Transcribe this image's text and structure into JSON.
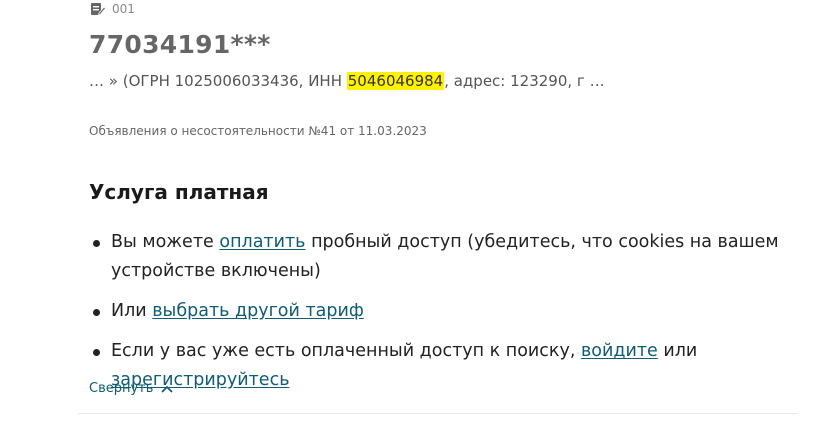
{
  "result": {
    "doc_icon": "document-edit-icon",
    "code": "001",
    "title": "77034191***",
    "snippet_before": "… » (ОГРН 1025006033436, ИНН ",
    "snippet_highlight": "5046046984",
    "snippet_after": ", адрес: 123290, г …",
    "source": "Объявления о несостоятельности №41 от 11.03.2023"
  },
  "paywall": {
    "title": "Услуга платная",
    "item1_before": "Вы можете ",
    "item1_link": "оплатить",
    "item1_after": " пробный доступ (убедитесь, что cookies на вашем устройстве включены)",
    "item2_before": "Или ",
    "item2_link": "выбрать другой тариф",
    "item3_before": "Если у вас уже есть оплаченный доступ к поиску, ",
    "item3_link1": "войдите",
    "item3_middle": " или ",
    "item3_link2": "зарегистрируйтесь"
  },
  "collapse": {
    "label": "Свернуть",
    "icon": "chevron-up-icon"
  },
  "colors": {
    "link": "#0f5c73",
    "highlight": "#fff200",
    "title_gray": "#666666"
  }
}
